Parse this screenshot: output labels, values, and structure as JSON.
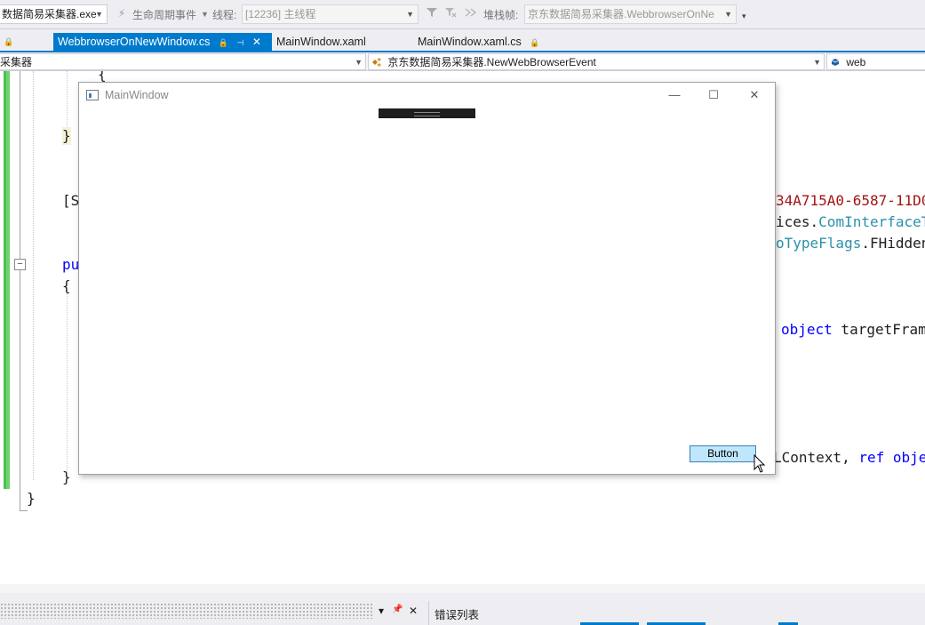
{
  "toolbar": {
    "process": "数据简易采集器.exe",
    "lifecycle_label": "生命周期事件",
    "thread_label": "线程:",
    "thread_value": "[12236] 主线程",
    "stackframe_label": "堆栈帧:",
    "stackframe_value": "京东数据简易采集器.WebbrowserOnNe"
  },
  "tabs": [
    {
      "label": "WebbrowserOnNewWindow.cs",
      "active": true
    },
    {
      "label": "MainWindow.xaml",
      "active": false
    },
    {
      "label": "MainWindow.xaml.cs",
      "active": false
    }
  ],
  "navbar": {
    "project": "采集器",
    "member": "京东数据简易采集器.NewWebBrowserEvent",
    "field": "web"
  },
  "code": {
    "brace_open_top": "{",
    "brace_close_indent": "}",
    "attr_start": "[S",
    "guid_fragment": "34A715A0-6587-11D0",
    "interop_prefix": "ices.",
    "interop_type": "ComInterfaceT",
    "flags_type": "oTypeFlags",
    "flags_suffix": ".FHidden",
    "pub": "pu",
    "brace_open": "{",
    "object_kw": "object",
    "target_frame": " targetFram",
    "lcontext": "LContext, ",
    "ref_kw": "ref",
    "obj_frag": " obje",
    "brace_close_method": "}",
    "brace_close_class": "}"
  },
  "window": {
    "title": "MainWindow",
    "button_label": "Button",
    "min_glyph": "—",
    "max_glyph": "☐",
    "close_glyph": "✕"
  },
  "bottom_panel": {
    "title": "错误列表",
    "dropdown_glyph": "▾",
    "pin_glyph": "📌",
    "close_glyph": "✕"
  }
}
